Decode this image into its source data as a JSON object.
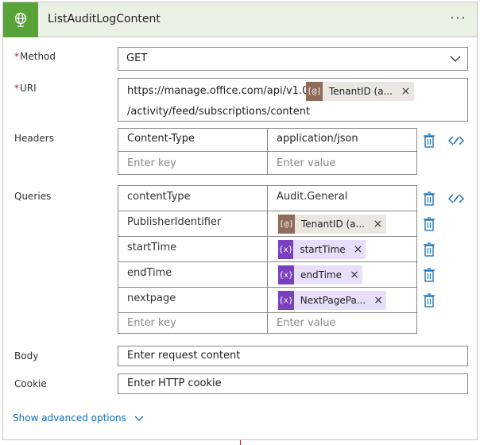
{
  "action": {
    "title": "ListAuditLogContent",
    "icon": "globe-icon",
    "menu_label": "···",
    "header_bg": "#e9f0e4",
    "icon_bg": "#58a338"
  },
  "fields": {
    "method": {
      "label": "Method",
      "required_mark": "*",
      "value": "GET"
    },
    "uri": {
      "label": "URI",
      "required_mark": "*",
      "text_before": "https://manage.office.com/api/v1.0/",
      "token": {
        "label": "TenantID (a...",
        "kind": "api-token"
      },
      "text_after": "/activity/feed/subscriptions/content"
    },
    "headers": {
      "label": "Headers",
      "rows": [
        {
          "key": "Content-Type",
          "value": "application/json"
        }
      ],
      "placeholder_key": "Enter key",
      "placeholder_value": "Enter value"
    },
    "queries": {
      "label": "Queries",
      "rows": [
        {
          "key": "contentType",
          "value": "Audit.General"
        },
        {
          "key": "PublisherIdentifier",
          "token": "TenantID (a...",
          "token_kind": "api-token"
        },
        {
          "key": "startTime",
          "token": "startTime",
          "token_kind": "variable"
        },
        {
          "key": "endTime",
          "token": "endTime",
          "token_kind": "variable"
        },
        {
          "key": "nextpage",
          "token": "NextPagePa...",
          "token_kind": "variable"
        }
      ],
      "placeholder_key": "Enter key",
      "placeholder_value": "Enter value"
    },
    "body": {
      "label": "Body",
      "placeholder": "Enter request content"
    },
    "cookie": {
      "label": "Cookie",
      "placeholder": "Enter HTTP cookie"
    }
  },
  "token_glyphs": {
    "api": "[@]",
    "variable": "{x}",
    "remove": "×"
  },
  "advanced": {
    "label": "Show advanced options"
  },
  "colors": {
    "accent_link": "#0f6cbd",
    "required": "#a4262c",
    "api_token_bg": "#ece6e1",
    "api_token_icon": "#8f6b5b",
    "var_token_bg": "#e9defa",
    "var_token_icon": "#7a3fbf"
  }
}
